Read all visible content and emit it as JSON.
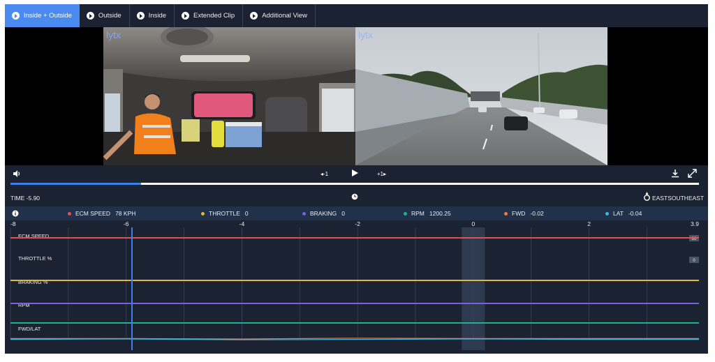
{
  "tabs": [
    {
      "label": "Inside + Outside",
      "active": true
    },
    {
      "label": "Outside",
      "active": false
    },
    {
      "label": "Inside",
      "active": false
    },
    {
      "label": "Extended Clip",
      "active": false
    },
    {
      "label": "Additional View",
      "active": false
    }
  ],
  "video": {
    "watermark_inside": "lytx",
    "watermark_outside": "lytx"
  },
  "player": {
    "back_label": "-1",
    "forward_label": "+1",
    "progress": 0.19
  },
  "info": {
    "time": "TIME -5.90",
    "heading": "EASTSOUTHEAST"
  },
  "legend": [
    {
      "name": "ECM SPEED",
      "value": "78 KPH",
      "color": "#e05252"
    },
    {
      "name": "THROTTLE",
      "value": "0",
      "color": "#e0b93a"
    },
    {
      "name": "BRAKING",
      "value": "0",
      "color": "#7b5fe0"
    },
    {
      "name": "RPM",
      "value": "1200.25",
      "color": "#1fb38a"
    },
    {
      "name": "FWD",
      "value": "-0.02",
      "color": "#f07a45"
    },
    {
      "name": "LAT",
      "value": "-0.04",
      "color": "#3ab8e0"
    }
  ],
  "chart_data": {
    "type": "line",
    "x_ticks": [
      "-8",
      "-6",
      "-4",
      "-2",
      "0",
      "2",
      "3.9"
    ],
    "xlim": [
      -8,
      3.9
    ],
    "cursor_x": -5.9,
    "lanes": [
      {
        "label": "ECM SPEED",
        "badge": "90"
      },
      {
        "label": "THROTTLE %",
        "badge": "0"
      },
      {
        "label": "BRAKING %",
        "badge": ""
      },
      {
        "label": "RPM",
        "badge": ""
      },
      {
        "label": "FWD/LAT",
        "badge": ""
      }
    ],
    "series": [
      {
        "name": "ECM SPEED",
        "lane": 0,
        "x": [
          -8,
          3.9
        ],
        "y": [
          78,
          78
        ]
      },
      {
        "name": "THROTTLE",
        "lane": 2,
        "x": [
          -8,
          3.9
        ],
        "y": [
          0,
          0
        ]
      },
      {
        "name": "BRAKING",
        "lane": 3,
        "x": [
          -8,
          3.9
        ],
        "y": [
          0,
          0
        ]
      },
      {
        "name": "RPM",
        "lane": 4,
        "x": [
          -8,
          3.9
        ],
        "y": [
          1200.25,
          1200.25
        ]
      },
      {
        "name": "FWD",
        "lane": 5,
        "x": [
          -8,
          -6,
          -4,
          -2,
          0,
          2,
          3.9
        ],
        "y": [
          -0.02,
          -0.02,
          -0.03,
          -0.01,
          -0.02,
          -0.02,
          -0.02
        ]
      },
      {
        "name": "LAT",
        "lane": 5,
        "x": [
          -8,
          -6,
          -4,
          -2,
          0,
          2,
          3.9
        ],
        "y": [
          -0.04,
          -0.03,
          -0.05,
          -0.04,
          -0.03,
          -0.04,
          -0.04
        ]
      }
    ],
    "colors": {
      "highlight_band": "#2e3a50",
      "cursor": "#3f7fe8",
      "grid": "#3a4458"
    }
  }
}
